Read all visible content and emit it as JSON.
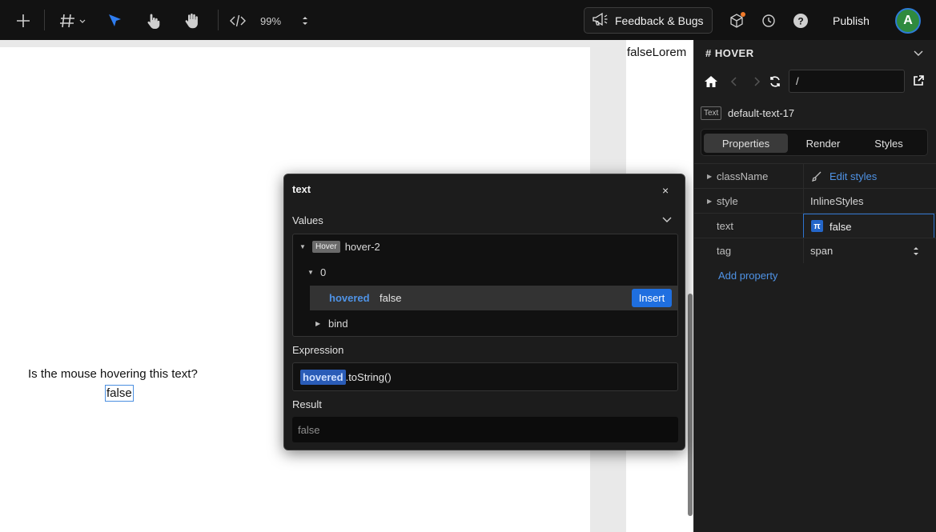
{
  "toolbar": {
    "zoom": "99%",
    "feedback_label": "Feedback & Bugs",
    "publish_label": "Publish",
    "avatar_initial": "A"
  },
  "canvas": {
    "top_right_text": "falseLorem",
    "question_text": "Is the mouse hovering this text?",
    "value_text": "false"
  },
  "popover": {
    "title": "text",
    "close": "×",
    "values_label": "Values",
    "tree": {
      "badge": "Hover",
      "root": "hover-2",
      "index": "0",
      "key": "hovered",
      "value": "false",
      "insert_label": "Insert",
      "bind": "bind"
    },
    "expression_label": "Expression",
    "expression_token": "hovered",
    "expression_rest": ".toString()",
    "result_label": "Result",
    "result_value": "false"
  },
  "panel": {
    "heading": "HOVER",
    "path": "/",
    "tag_badge": "Text",
    "component_name": "default-text-17",
    "tabs": [
      {
        "label": "Properties"
      },
      {
        "label": "Render"
      },
      {
        "label": "Styles"
      }
    ],
    "props": [
      {
        "name": "className",
        "value": "Edit styles"
      },
      {
        "name": "style",
        "value": "InlineStyles"
      },
      {
        "name": "text",
        "value": "false"
      },
      {
        "name": "tag",
        "value": "span"
      }
    ],
    "add_property": "Add property"
  },
  "colors": {
    "accent": "#1f6fe0",
    "link": "#4f93e6"
  }
}
